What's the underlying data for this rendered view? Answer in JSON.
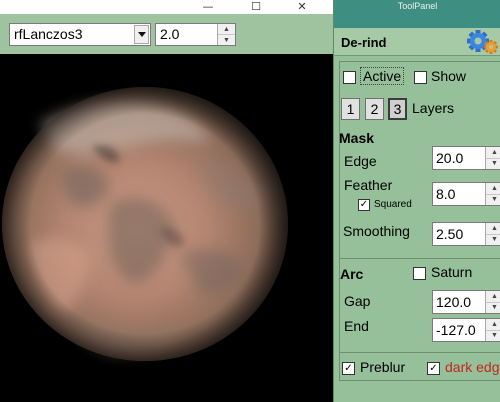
{
  "image_window": {
    "controls": {
      "minimize": "—",
      "maximize": "☐",
      "close": "✕"
    },
    "filter": {
      "value": "rfLanczos3"
    },
    "scale": {
      "value": "2.0"
    },
    "viewport": {
      "background": "#000000"
    }
  },
  "tool_panel": {
    "title": "ToolPanel",
    "heading": "De-rind",
    "active": {
      "label": "Active",
      "checked": false
    },
    "show": {
      "label": "Show",
      "checked": false
    },
    "layers": {
      "buttons": [
        "1",
        "2",
        "3"
      ],
      "selected": "3",
      "label": "Layers"
    },
    "mask": {
      "heading": "Mask",
      "edge": {
        "label": "Edge",
        "value": "20.0"
      },
      "feather": {
        "label": "Feather",
        "value": "8.0"
      },
      "squared": {
        "label": "Squared",
        "checked": true
      },
      "smoothing": {
        "label": "Smoothing",
        "value": "2.50"
      }
    },
    "arc": {
      "heading": "Arc",
      "saturn": {
        "label": "Saturn",
        "checked": false
      },
      "gap": {
        "label": "Gap",
        "value": "120.0"
      },
      "end": {
        "label": "End",
        "value": "-127.0"
      }
    },
    "preblur": {
      "label": "Preblur",
      "checked": true
    },
    "dark_edge": {
      "label": "dark edg",
      "checked": true,
      "color": "#c0281c"
    }
  },
  "colors": {
    "toolbar_bg": "#9fc29f",
    "panel_bg": "#96c09a",
    "panel_title_bg": "#3e8f81",
    "planet": "#b98a74"
  },
  "icons": {
    "gear": "gear-icon",
    "dropdown": "chevron-down-icon",
    "spin": "spin-up-down-icon"
  }
}
